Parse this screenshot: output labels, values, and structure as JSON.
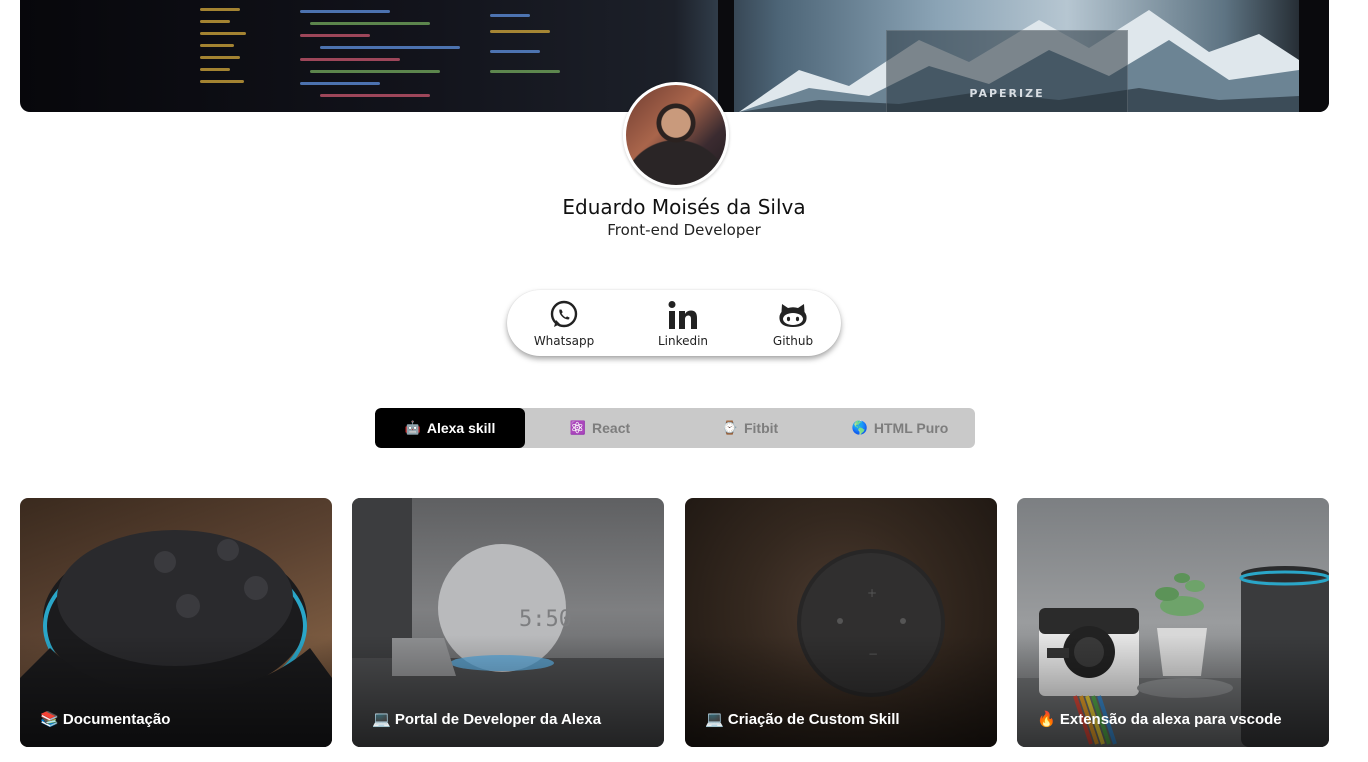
{
  "profile": {
    "name": "Eduardo Moisés da Silva",
    "role": "Front-end Developer"
  },
  "cover": {
    "screen_text": "PAPERIZE"
  },
  "social": [
    {
      "label": "Whatsapp",
      "icon": "whatsapp-icon"
    },
    {
      "label": "Linkedin",
      "icon": "linkedin-icon"
    },
    {
      "label": "Github",
      "icon": "github-icon"
    }
  ],
  "tabs": [
    {
      "emoji": "🤖",
      "label": "Alexa skill",
      "active": true
    },
    {
      "emoji": "⚛️",
      "label": "React",
      "active": false
    },
    {
      "emoji": "⌚",
      "label": "Fitbit",
      "active": false
    },
    {
      "emoji": "🌎",
      "label": "HTML Puro",
      "active": false
    }
  ],
  "cards": [
    {
      "emoji": "📚",
      "title": "Documentação"
    },
    {
      "emoji": "💻",
      "title": "Portal de Developer da Alexa"
    },
    {
      "emoji": "💻",
      "title": "Criação de Custom Skill"
    },
    {
      "emoji": "🔥",
      "title": "Extensão da alexa para vscode"
    }
  ],
  "colors": {
    "tab_active_bg": "#000000",
    "tab_bar_bg": "#c9c9c9",
    "tab_inactive_text": "#7d7d7d"
  }
}
